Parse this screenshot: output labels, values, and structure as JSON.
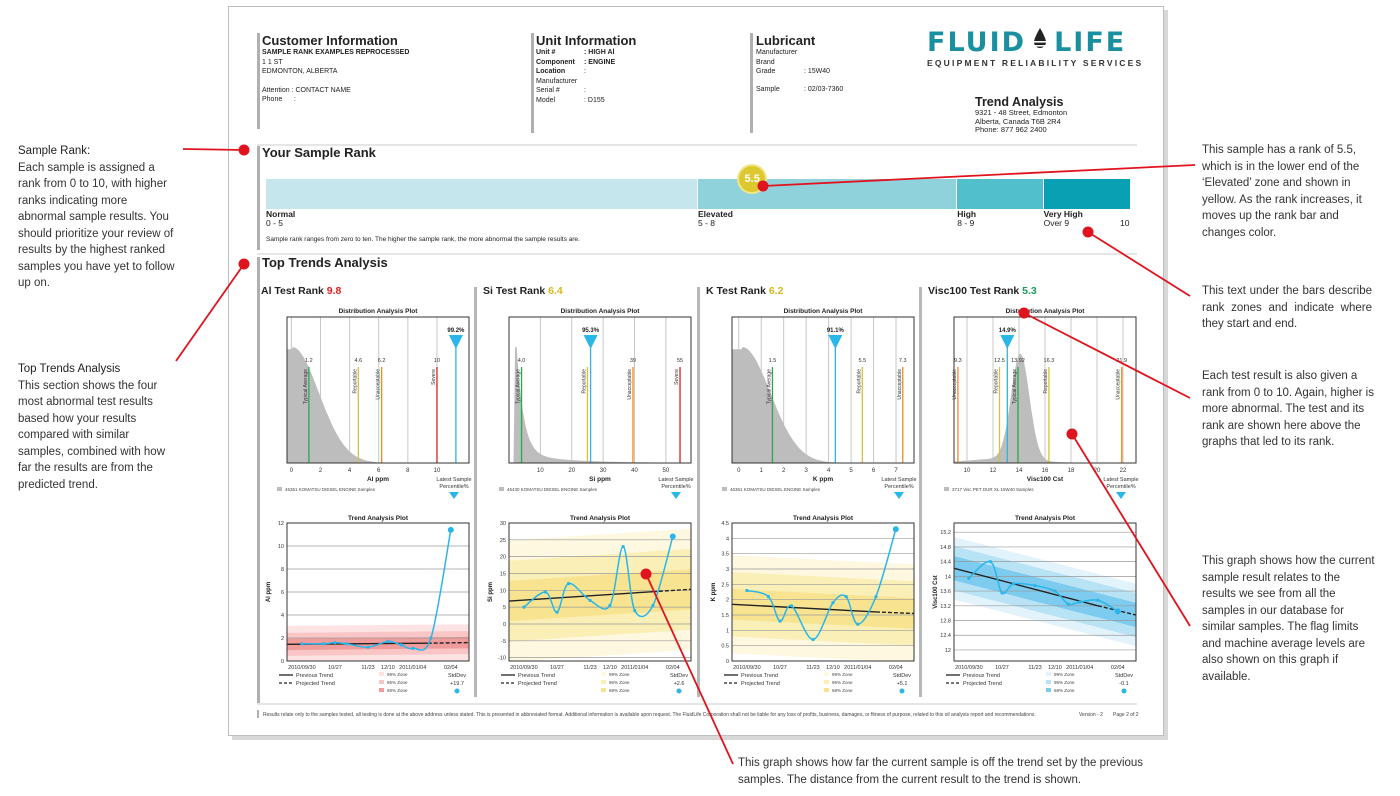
{
  "customer": {
    "title": "Customer Information",
    "name": "SAMPLE RANK EXAMPLES REPROCESSED",
    "address1": "1 1 ST",
    "address2": "EDMONTON, ALBERTA",
    "attention": "Attention : CONTACT NAME",
    "phone": "Phone      :"
  },
  "unit": {
    "title": "Unit Information",
    "rows": [
      {
        "k": "Unit #",
        "v": ": HIGH Al"
      },
      {
        "k": "Component",
        "v": ": ENGINE"
      },
      {
        "k": "Location",
        "v": ":"
      },
      {
        "k": "Manufacturer",
        "v": ""
      },
      {
        "k": "Serial #",
        "v": ":"
      },
      {
        "k": "Model",
        "v": ": D155"
      }
    ]
  },
  "lubricant": {
    "title": "Lubricant",
    "rows": [
      {
        "k": "Manufacturer",
        "v": ""
      },
      {
        "k": "Brand",
        "v": ""
      },
      {
        "k": "Grade",
        "v": ": 15W40"
      },
      {
        "k": "Sample",
        "v": ": 02/03-7360"
      }
    ]
  },
  "brand": {
    "logo_left": "FLUID",
    "logo_right": "LIFE",
    "tagline": "EQUIPMENT RELIABILITY SERVICES",
    "report_title": "Trend Analysis",
    "address1": "9321 - 48 Street, Edmonton",
    "address2": "Alberta, Canada T6B 2R4",
    "phone": "Phone: 877 962 2400",
    "color": "#1a8fa0"
  },
  "sample_rank": {
    "title": "Your Sample Rank",
    "value": "5.5",
    "rank_value": 5.5,
    "max": 10,
    "zones": [
      {
        "name": "Normal",
        "range": "0 - 5",
        "from": 0,
        "to": 5,
        "color": "#c5e6ed"
      },
      {
        "name": "Elevated",
        "range": "5 - 8",
        "from": 5,
        "to": 8,
        "color": "#8fd2dc"
      },
      {
        "name": "High",
        "range": "8 - 9",
        "from": 8,
        "to": 9,
        "color": "#52bfcc"
      },
      {
        "name": "Very High",
        "range": "Over 9",
        "from": 9,
        "to": 10,
        "color": "#0aa0b3"
      }
    ],
    "end_label": "10",
    "note": "Sample rank ranges from zero to ten. The higher the sample rank, the more abnormal the sample results are."
  },
  "top_trends": {
    "title": "Top Trends Analysis"
  },
  "tests": [
    {
      "name": "Al Test Rank",
      "rank": "9.8",
      "rank_color": "#e02020",
      "dist": {
        "title": "Distribution Analysis Plot",
        "xlabel": "Al ppm",
        "xticks": [
          0,
          2,
          4,
          6,
          8,
          10
        ],
        "xmin": -0.3,
        "xmax": 12.2,
        "shape": "decay",
        "peak": 0.05,
        "spread": 2.2,
        "markers": [
          {
            "label": "Typical Average",
            "value": 1.2,
            "text": "1.2",
            "color": "#2aa84a"
          },
          {
            "label": "Reportable",
            "value": 4.6,
            "text": "4.6",
            "color": "#d6c040"
          },
          {
            "label": "Unacceptable",
            "value": 6.2,
            "text": "6.2",
            "color": "#f08a20"
          },
          {
            "label": "Severe",
            "value": 10,
            "text": "10",
            "color": "#e02020"
          }
        ],
        "latest": {
          "value": 11.3,
          "percentile": "99.2%"
        },
        "legend": "46361 KOMATSU DIESEL ENGINE Samples",
        "latest_label": "Latest Sample Percentile%"
      },
      "trend": {
        "title": "Trend Analysis Plot",
        "ylabel": "Al ppm",
        "yticks": [
          0,
          2,
          4,
          6,
          8,
          10,
          12
        ],
        "ymin": 0,
        "ymax": 12,
        "xticks": [
          "2010/09/30",
          "10/27",
          "11/23",
          "12/10",
          "2011/01/04",
          "02/04"
        ],
        "xtick_pos": [
          0.9,
          2.9,
          4.9,
          6.1,
          7.6,
          9.9
        ],
        "points": [
          [
            0.9,
            1.5
          ],
          [
            2.2,
            1.5
          ],
          [
            2.9,
            1.6
          ],
          [
            3.6,
            1.5
          ],
          [
            4.9,
            1.2
          ],
          [
            6.1,
            1.7
          ],
          [
            6.9,
            1.4
          ],
          [
            7.6,
            1.1
          ],
          [
            8.7,
            2.0
          ],
          [
            9.9,
            11.4
          ]
        ],
        "trend_start": [
          0,
          1.45
        ],
        "trend_end": [
          8.5,
          1.55
        ],
        "proj_end": [
          11,
          1.6
        ],
        "zones": {
          "z99": 1.6,
          "z95": 1.0,
          "z68": 0.5,
          "slope": 0
        },
        "zone_colors": [
          "#fde3e3",
          "#f9c5c5",
          "#f19c9c"
        ],
        "zone_labels": [
          "99% Zone",
          "95% Zone",
          "68% Zone"
        ],
        "legend_prev": "Previous Trend",
        "legend_proj": "Projected Trend",
        "stddev_label": "StdDev",
        "stddev": "+19.7"
      }
    },
    {
      "name": "Si Test Rank",
      "rank": "6.4",
      "rank_color": "#d4b91e",
      "dist": {
        "title": "Distribution Analysis Plot",
        "xlabel": "Si ppm",
        "xticks": [
          10,
          20,
          30,
          40,
          50
        ],
        "xmin": 0,
        "xmax": 58,
        "shape": "sharp",
        "peak": 2.5,
        "spread": 2.2,
        "markers": [
          {
            "label": "Typical Average",
            "value": 4.0,
            "text": "4.0",
            "color": "#2aa84a"
          },
          {
            "label": "Reportable",
            "value": 25,
            "text": "",
            "color": "#d6c040"
          },
          {
            "label": "Unacceptable",
            "value": 39.5,
            "text": "39",
            "color": "#f08a20"
          },
          {
            "label": "Severe",
            "value": 54.5,
            "text": "55",
            "color": "#e02020"
          }
        ],
        "latest": {
          "value": 26,
          "percentile": "95.3%"
        },
        "legend": "46430 KOMATSU DIESEL ENGINE Samples",
        "latest_label": "Latest Sample Percentile%"
      },
      "trend": {
        "title": "Trend Analysis Plot",
        "ylabel": "Si ppm",
        "yticks": [
          -10,
          -5,
          0,
          5,
          10,
          15,
          20,
          25,
          30
        ],
        "ymin": -11,
        "ymax": 30,
        "xticks": [
          "2010/09/30",
          "10/27",
          "11/23",
          "12/10",
          "2011/01/04",
          "02/04"
        ],
        "xtick_pos": [
          0.9,
          2.9,
          4.9,
          6.1,
          7.6,
          9.9
        ],
        "points": [
          [
            0.9,
            5
          ],
          [
            2.2,
            9.5
          ],
          [
            2.9,
            3.5
          ],
          [
            3.6,
            12
          ],
          [
            4.9,
            7
          ],
          [
            6.1,
            5.5
          ],
          [
            6.9,
            23
          ],
          [
            7.6,
            4
          ],
          [
            8.7,
            5.5
          ],
          [
            9.9,
            26
          ]
        ],
        "trend_start": [
          0,
          6.8
        ],
        "trend_end": [
          8.7,
          9.6
        ],
        "proj_end": [
          11,
          10.3
        ],
        "zones": {
          "z99": 18,
          "z95": 12,
          "z68": 6,
          "slope": 0.32
        },
        "zone_colors": [
          "#fdf8df",
          "#fbefb8",
          "#f8e490"
        ],
        "zone_labels": [
          "99% Zone",
          "95% Zone",
          "68% Zone"
        ],
        "legend_prev": "Previous Trend",
        "legend_proj": "Projected Trend",
        "stddev_label": "StdDev",
        "stddev": "+2.6"
      }
    },
    {
      "name": "K Test Rank",
      "rank": "6.2",
      "rank_color": "#d4b91e",
      "dist": {
        "title": "Distribution Analysis Plot",
        "xlabel": "K ppm",
        "xticks": [
          0,
          1,
          2,
          3,
          4,
          5,
          6,
          7
        ],
        "xmin": -0.3,
        "xmax": 7.8,
        "shape": "decay",
        "peak": 0.15,
        "spread": 1.5,
        "markers": [
          {
            "label": "Typical Average",
            "value": 1.5,
            "text": "1.5",
            "color": "#2aa84a"
          },
          {
            "label": "Reportable",
            "value": 5.5,
            "text": "5.5",
            "color": "#d6c040"
          },
          {
            "label": "Unacceptable",
            "value": 7.3,
            "text": "7.3",
            "color": "#f08a20"
          }
        ],
        "latest": {
          "value": 4.3,
          "percentile": "91.1%"
        },
        "legend": "46361 KOMATSU DIESEL ENGINE Samples",
        "latest_label": "Latest Sample Percentile%"
      },
      "trend": {
        "title": "Trend Analysis Plot",
        "ylabel": "K ppm",
        "yticks": [
          0,
          0.5,
          1,
          1.5,
          2,
          2.5,
          3,
          3.5,
          4,
          4.5
        ],
        "ymin": 0,
        "ymax": 4.5,
        "xticks": [
          "2010/09/30",
          "10/27",
          "11/23",
          "12/10",
          "2011/01/04",
          "02/04"
        ],
        "xtick_pos": [
          0.9,
          2.9,
          4.9,
          6.1,
          7.6,
          9.9
        ],
        "points": [
          [
            0.9,
            2.3
          ],
          [
            2.2,
            2.1
          ],
          [
            2.9,
            1.3
          ],
          [
            3.6,
            1.8
          ],
          [
            4.9,
            0.7
          ],
          [
            6.1,
            1.9
          ],
          [
            6.9,
            2.1
          ],
          [
            7.6,
            1.2
          ],
          [
            8.7,
            2.1
          ],
          [
            9.9,
            4.3
          ]
        ],
        "trend_start": [
          0,
          1.85
        ],
        "trend_end": [
          8.7,
          1.6
        ],
        "proj_end": [
          11,
          1.55
        ],
        "zones": {
          "z99": 1.6,
          "z95": 1.05,
          "z68": 0.5,
          "slope": -0.03
        },
        "zone_colors": [
          "#fdf8df",
          "#fbefb8",
          "#f8e490"
        ],
        "zone_labels": [
          "99% Zone",
          "95% Zone",
          "68% Zone"
        ],
        "legend_prev": "Previous Trend",
        "legend_proj": "Projected Trend",
        "stddev_label": "StdDev",
        "stddev": "+5.1"
      }
    },
    {
      "name": "Visc100 Test Rank",
      "rank": "5.3",
      "rank_color": "#1a9a5a",
      "dist": {
        "title": "Distribution Analysis Plot",
        "xlabel": "Visc100 Cst",
        "xticks": [
          10,
          12,
          14,
          16,
          18,
          20,
          22
        ],
        "xmin": 9,
        "xmax": 23,
        "shape": "bell",
        "peak": 14.1,
        "spread": 0.7,
        "markers": [
          {
            "label": "Unacceptable",
            "value": 9.3,
            "text": "9.3",
            "color": "#f08a20"
          },
          {
            "label": "Reportable",
            "value": 12.5,
            "text": "12.5",
            "color": "#d6c040"
          },
          {
            "label": "Typical Average",
            "value": 13.92,
            "text": "13.92",
            "color": "#2aa84a"
          },
          {
            "label": "Reportable",
            "value": 16.3,
            "text": "16.3",
            "color": "#d6c040"
          },
          {
            "label": "Unacceptable",
            "value": 21.9,
            "text": "21.9",
            "color": "#f08a20"
          }
        ],
        "latest": {
          "value": 13.1,
          "percentile": "14.9%"
        },
        "legend": "3717 Visc PET DUR XL 15W40 Samples",
        "latest_label": "Latest Sample Percentile%"
      },
      "trend": {
        "title": "Trend Analysis Plot",
        "ylabel": "Visc100 Cst",
        "yticks": [
          12,
          12.4,
          12.8,
          13.2,
          13.6,
          14,
          14.4,
          14.8,
          15.2
        ],
        "ymin": 11.7,
        "ymax": 15.45,
        "xticks": [
          "2010/09/30",
          "10/27",
          "11/23",
          "12/10",
          "2011/01/04",
          "02/04"
        ],
        "xtick_pos": [
          0.9,
          2.9,
          4.9,
          6.1,
          7.6,
          9.9
        ],
        "points": [
          [
            0.9,
            13.95
          ],
          [
            2.2,
            14.4
          ],
          [
            2.9,
            13.55
          ],
          [
            3.6,
            13.8
          ],
          [
            4.9,
            13.75
          ],
          [
            6.1,
            13.6
          ],
          [
            6.9,
            13.25
          ],
          [
            7.6,
            13.3
          ],
          [
            8.7,
            13.35
          ],
          [
            9.9,
            13.05
          ]
        ],
        "trend_start": [
          0,
          14.22
        ],
        "trend_end": [
          8.7,
          13.2
        ],
        "proj_end": [
          11,
          12.95
        ],
        "zones": {
          "z99": 0.85,
          "z95": 0.6,
          "z68": 0.33,
          "slope": -0.115
        },
        "zone_colors": [
          "#e3f3fb",
          "#b8e3f5",
          "#7dcbee"
        ],
        "zone_labels": [
          "99% Zone",
          "95% Zone",
          "68% Zone"
        ],
        "legend_prev": "Previous Trend",
        "legend_proj": "Projected Trend",
        "stddev_label": "StdDev",
        "stddev": "-0.1"
      }
    }
  ],
  "footer": {
    "disclaimer": "Results relate only to the samples tested, all testing is done at the above address unless stated. This is presented in abbreviated format. Additional information is available upon request. The FluidLife Corporation shall not be liable for any loss of profits, business, damages, or fitness of purpose, related to this oil analysis report and recommendations.",
    "version": "Version - 2",
    "page": "Page 2 of 2"
  },
  "annotations": {
    "sample_rank_title": "Sample Rank:",
    "sample_rank_body": "Each sample is assigned a rank from 0 to 10, with higher ranks indicating more abnormal sample results. You should prioritize your review of results by the highest ranked samples you have yet to follow up on.",
    "top_trends_title": "Top Trends Analysis",
    "top_trends_body": "This section shows the four most abnormal test results based how your results compared with similar samples, combined with how far the results are from the predicted trend.",
    "rank_value_note": "This sample has a rank of 5.5, which is in the lower end of the ‘Elevated’ zone and shown in yellow. As the rank increases, it moves up the rank bar and changes color.",
    "zones_note": "This text under the bars describe rank zones and indicate where they start and end.",
    "test_rank_note": "Each test result is also given a rank from 0 to 10. Again, higher is more abnormal. The test and its rank are shown here above the graphs that led to its rank.",
    "distribution_note": "This graph shows how the current sample result relates to the results we see from all the samples in our database for similar samples. The flag limits and machine average levels are also shown on this graph if available.",
    "trend_note": "This graph shows how far the current sample is off the trend set by the previous samples. The distance from the current result to the trend is shown."
  },
  "colors": {
    "callout": "#e0141e",
    "latest_marker": "#29b6e8"
  }
}
